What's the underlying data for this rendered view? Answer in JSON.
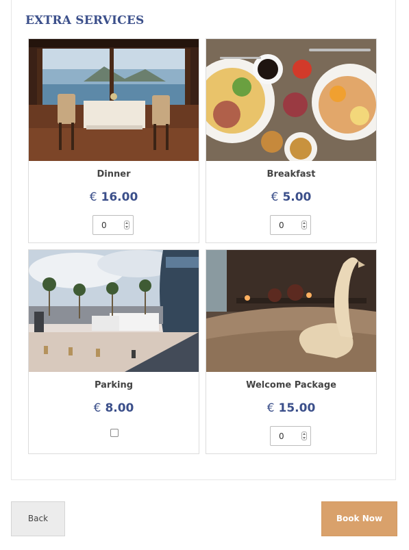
{
  "section": {
    "title": "EXTRA SERVICES"
  },
  "services": [
    {
      "name": "Dinner",
      "currency": "€",
      "price": "16.00",
      "control": "stepper",
      "quantity": "0",
      "image": "dining-room-photo"
    },
    {
      "name": "Breakfast",
      "currency": "€",
      "price": "5.00",
      "control": "stepper",
      "quantity": "0",
      "image": "breakfast-table-photo"
    },
    {
      "name": "Parking",
      "currency": "€",
      "price": "8.00",
      "control": "checkbox",
      "checked": false,
      "image": "parking-lot-photo"
    },
    {
      "name": "Welcome Package",
      "currency": "€",
      "price": "15.00",
      "control": "stepper",
      "quantity": "0",
      "image": "towel-swan-photo"
    }
  ],
  "actions": {
    "back_label": "Back",
    "book_label": "Book Now"
  },
  "colors": {
    "accent": "#3b4f8a",
    "book_button": "#d9a16b",
    "back_button": "#ececec"
  }
}
